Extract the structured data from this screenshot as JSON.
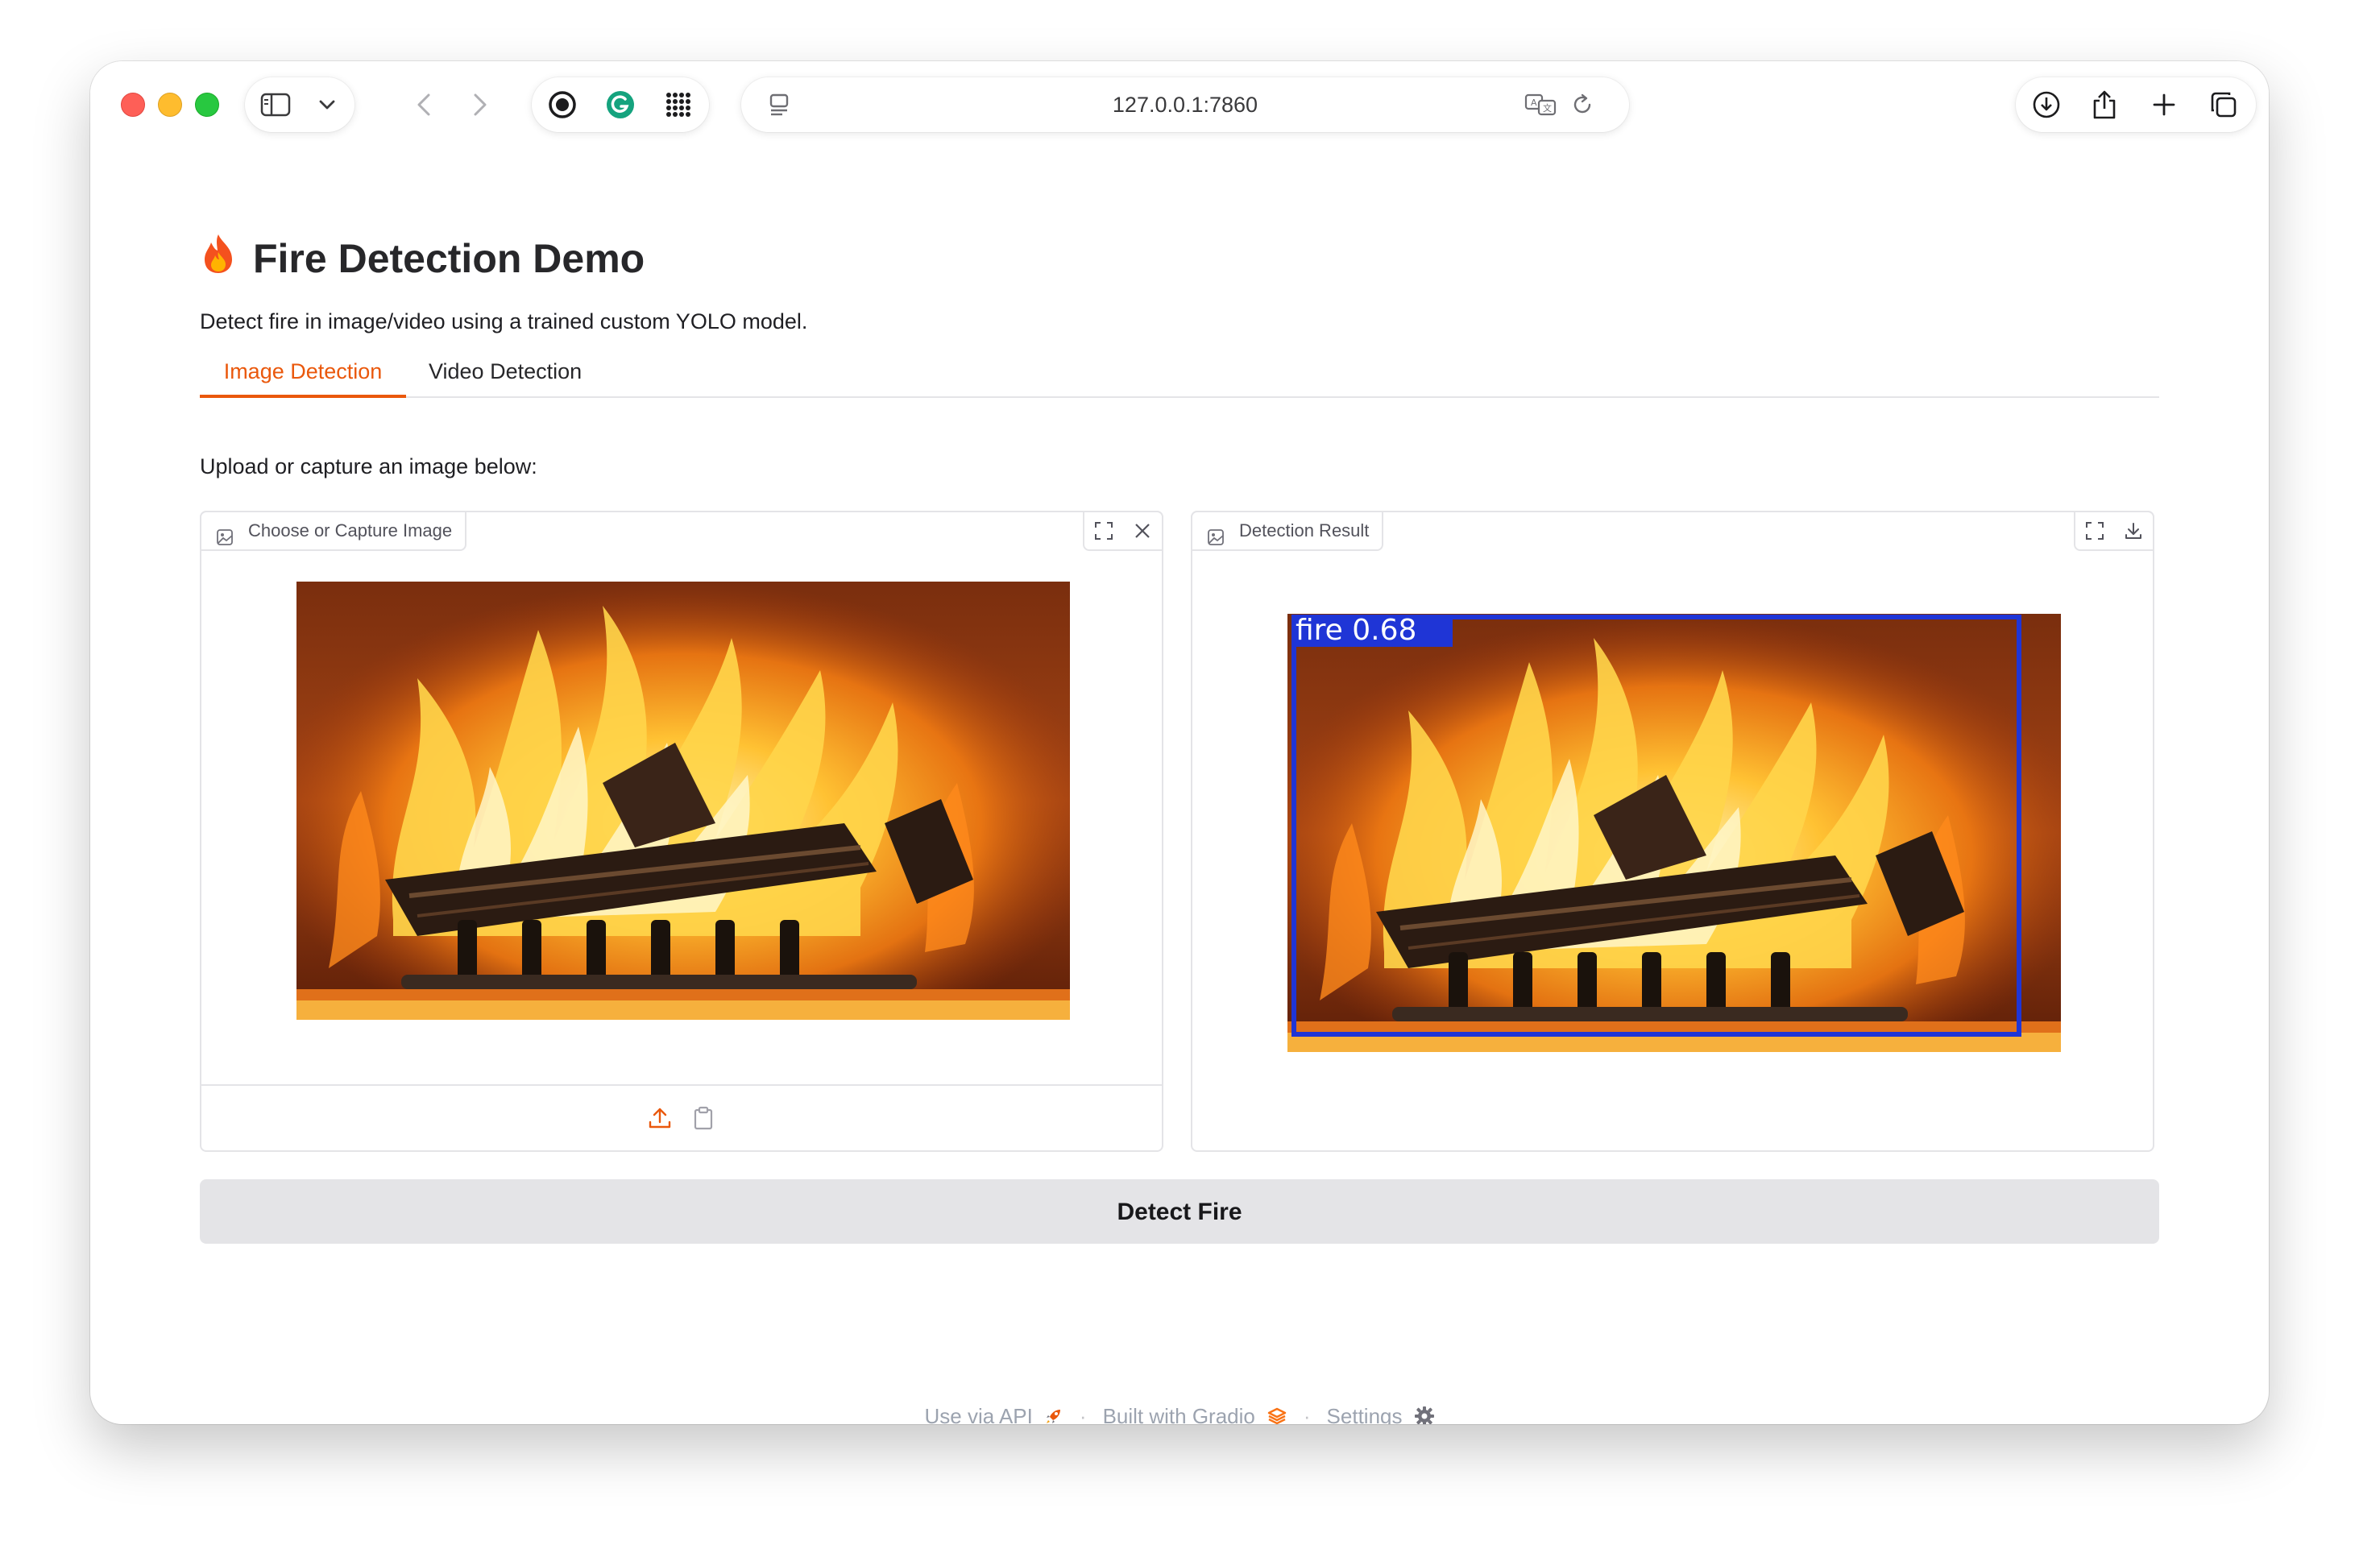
{
  "browser": {
    "url": "127.0.0.1:7860",
    "icons": [
      "sidebar-icon",
      "chevron-down-icon",
      "back-icon",
      "forward-icon",
      "record-icon",
      "grammarly-icon",
      "apps-grid-icon",
      "reader-icon",
      "translate-icon",
      "reload-icon",
      "download-icon",
      "share-icon",
      "new-tab-icon",
      "tabs-overview-icon"
    ]
  },
  "app": {
    "title": "Fire Detection Demo",
    "description": "Detect fire in image/video using a trained custom YOLO model.",
    "tabs": [
      {
        "label": "Image Detection",
        "active": true
      },
      {
        "label": "Video Detection",
        "active": false
      }
    ],
    "prompt": "Upload or capture an image below:",
    "input_panel": {
      "label": "Choose or Capture Image"
    },
    "output_panel": {
      "label": "Detection Result",
      "detection_label": "fire 0.68"
    },
    "detect_button": "Detect Fire",
    "accent_color": "#ea580c"
  },
  "footer": {
    "api": "Use via API",
    "built": "Built with Gradio",
    "settings": "Settings",
    "separator": "·"
  }
}
